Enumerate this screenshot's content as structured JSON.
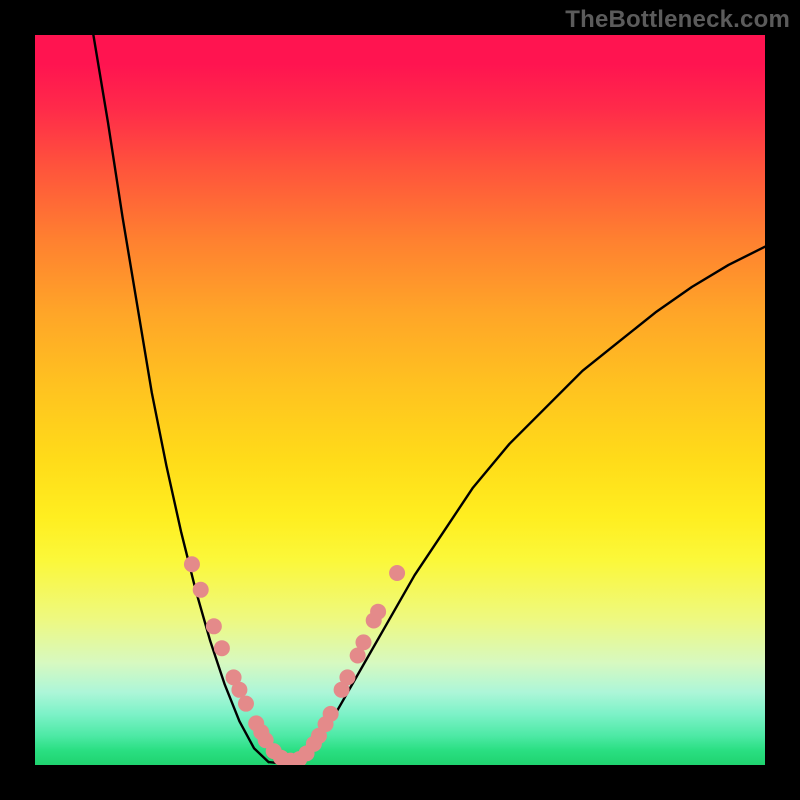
{
  "watermark": "TheBottleneck.com",
  "chart_data": {
    "type": "line",
    "title": "",
    "xlabel": "",
    "ylabel": "",
    "xlim": [
      0,
      100
    ],
    "ylim": [
      0,
      100
    ],
    "grid": false,
    "legend": false,
    "series": [
      {
        "name": "curve-left",
        "color": "#000000",
        "x": [
          8,
          10,
          12,
          14,
          16,
          18,
          20,
          22,
          24,
          26,
          28,
          30,
          32
        ],
        "y": [
          100,
          88,
          75,
          63,
          51,
          41,
          32,
          24,
          17,
          11,
          6,
          2.3,
          0.4
        ]
      },
      {
        "name": "curve-flat",
        "color": "#000000",
        "x": [
          32,
          34,
          36
        ],
        "y": [
          0.4,
          0.2,
          0.4
        ]
      },
      {
        "name": "curve-right",
        "color": "#000000",
        "x": [
          36,
          38,
          40,
          42,
          44,
          48,
          52,
          56,
          60,
          65,
          70,
          75,
          80,
          85,
          90,
          95,
          100
        ],
        "y": [
          0.4,
          2.1,
          5,
          8.5,
          12,
          19,
          26,
          32,
          38,
          44,
          49,
          54,
          58,
          62,
          65.5,
          68.5,
          71
        ]
      }
    ],
    "markers": {
      "name": "threshold-dots",
      "color": "#e48a8a",
      "radius_px": 8,
      "points_xy": [
        [
          21.5,
          27.5
        ],
        [
          22.7,
          24.0
        ],
        [
          24.5,
          19.0
        ],
        [
          25.6,
          16.0
        ],
        [
          27.2,
          12.0
        ],
        [
          28.0,
          10.3
        ],
        [
          28.9,
          8.4
        ],
        [
          30.3,
          5.7
        ],
        [
          31.0,
          4.5
        ],
        [
          31.6,
          3.4
        ],
        [
          32.7,
          1.9
        ],
        [
          33.7,
          1.0
        ],
        [
          35.0,
          0.6
        ],
        [
          36.2,
          0.8
        ],
        [
          37.2,
          1.6
        ],
        [
          38.2,
          2.9
        ],
        [
          38.9,
          4.0
        ],
        [
          39.8,
          5.6
        ],
        [
          40.5,
          7.0
        ],
        [
          42.0,
          10.3
        ],
        [
          42.8,
          12.0
        ],
        [
          44.2,
          15.0
        ],
        [
          45.0,
          16.8
        ],
        [
          46.4,
          19.8
        ],
        [
          47.0,
          21.0
        ],
        [
          49.6,
          26.3
        ]
      ]
    },
    "background_gradient": {
      "direction": "vertical",
      "stops": [
        {
          "pos": 0.0,
          "color": "#ff1450"
        },
        {
          "pos": 0.5,
          "color": "#ffd41c"
        },
        {
          "pos": 0.8,
          "color": "#eef980"
        },
        {
          "pos": 1.0,
          "color": "#1fd36f"
        }
      ]
    }
  }
}
